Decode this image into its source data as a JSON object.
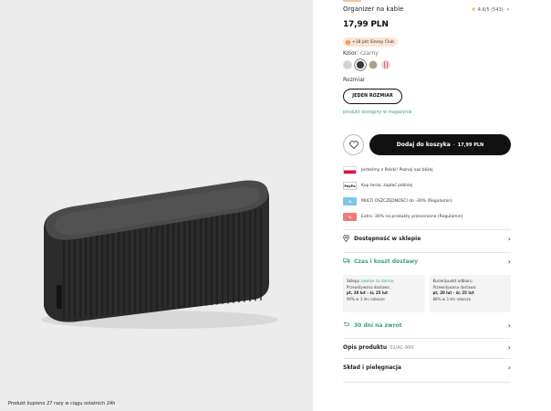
{
  "gallery": {
    "purchase_note": "Produkt kupiono 27 razy w ciągu ostatnich 24h"
  },
  "product": {
    "name": "Organizer na kable",
    "rating": "4,6/5 (543)",
    "price": "17,99 PLN",
    "club_badge": "+18 pkt Sinsay Club",
    "color_label": "Kolor:",
    "color_value": "czarny",
    "swatches": [
      "#d9cfc6",
      "#3a3a3a",
      "#b29a84",
      "#f3d4d4"
    ],
    "size_label": "Rozmiar",
    "size_value": "JEDEN ROZMIAR",
    "stock_note": "produkt dostępny w magazynie"
  },
  "actions": {
    "add_to_cart": "Dodaj do koszyka",
    "cart_price": "17,99 PLN"
  },
  "perks": [
    {
      "icon": "poland-flag-icon",
      "text": "Jesteśmy z Polski! Poznaj nas bliżej"
    },
    {
      "icon": "paypo-icon",
      "text": "Kup teraz, zapłać później"
    },
    {
      "icon": "discount-icon",
      "text": "MULTI OSZCZĘDNOŚCI do -30% (Regulamin)"
    },
    {
      "icon": "tag-icon",
      "text": "Extra -30% na produkty przecenione (Regulamin)"
    }
  ],
  "perk_icon_labels": [
    "",
    "PayPo",
    "%",
    "%"
  ],
  "sections": {
    "store": "Dostępność w sklepie",
    "delivery": "Czas i koszt dostawy",
    "returns": "30 dni na zwrot",
    "description": "Opis produktu",
    "description_code": "01/AC-99X",
    "composition": "Skład i pielęgnacja"
  },
  "delivery": {
    "store_title": "Sklepy",
    "store_free": "zawsze za darmo",
    "store_forecast": "Przewidywana dostawa:",
    "store_date": "pt, 20 lut - śr, 25 lut",
    "store_ontime": "90% w 3 dni robocze",
    "courier_title": "Kurier/punkt odbioru",
    "courier_forecast": "Przewidywana dostawa:",
    "courier_date": "pt, 20 lut - śr, 25 lut",
    "courier_ontime": "88% w 3 dni robocze"
  }
}
